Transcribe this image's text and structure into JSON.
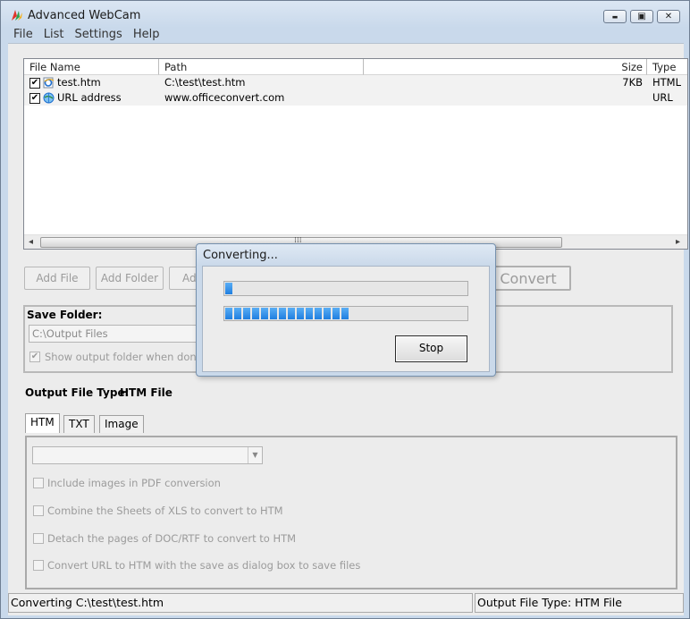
{
  "window": {
    "title": "Advanced WebCam",
    "minimize_glyph": "▬",
    "maximize_glyph": "▣",
    "close_glyph": "✕"
  },
  "menu": [
    "File",
    "List",
    "Settings",
    "Help"
  ],
  "file_list": {
    "columns": [
      "File Name",
      "Path",
      "Size",
      "Type"
    ],
    "rows": [
      {
        "checked": "✔",
        "icon": "ie-file-icon",
        "name": "test.htm",
        "path": "C:\\test\\test.htm",
        "size": "7KB",
        "type": "HTML"
      },
      {
        "checked": "✔",
        "icon": "url-globe-icon",
        "name": "URL address",
        "path": "www.officeconvert.com",
        "size": "",
        "type": "URL"
      }
    ],
    "scroll_left_glyph": "◂",
    "scroll_right_glyph": "▸",
    "scroll_grip": "⁞⁞⁞"
  },
  "toolbar": {
    "add_file": "Add File",
    "add_folder": "Add Folder",
    "add_partial": "Ad",
    "convert": "Convert"
  },
  "save_folder": {
    "label": "Save Folder:",
    "value": "C:\\Output Files",
    "show_folder": "Show output folder when done",
    "show_folder_checked": "✔"
  },
  "output_type": {
    "label": "Output File Type:",
    "value": "HTM File"
  },
  "tabs": [
    "HTM",
    "TXT",
    "Image"
  ],
  "options": [
    "Include images in PDF conversion",
    "Combine the Sheets of XLS to convert to HTM",
    "Detach the pages of DOC/RTF to convert to HTM",
    "Convert URL to HTM with the save as dialog box to save files"
  ],
  "status": {
    "left": "Converting  C:\\test\\test.htm",
    "right": "Output File Type:  HTM File"
  },
  "dialog": {
    "title": "Converting...",
    "stop": "Stop",
    "progress_file": 0.02,
    "progress_overall": 0.52
  },
  "colors": {
    "progress_fill": "#1f7ee0"
  }
}
